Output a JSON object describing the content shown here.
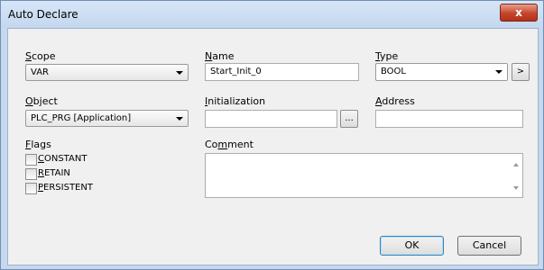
{
  "window": {
    "title": "Auto Declare",
    "close_label": "x"
  },
  "scope": {
    "label_ul": "S",
    "label_rest": "cope",
    "value": "VAR"
  },
  "name": {
    "label_ul": "N",
    "label_rest": "ame",
    "value": "Start_Init_0"
  },
  "type": {
    "label_ul": "T",
    "label_rest": "ype",
    "value": "BOOL",
    "browse_label": ">"
  },
  "object": {
    "label_ul": "O",
    "label_rest": "bject",
    "value": "PLC_PRG [Application]"
  },
  "initialization": {
    "label_ul": "I",
    "label_rest": "nitialization",
    "value": "",
    "browse_label": "..."
  },
  "address": {
    "label_ul": "A",
    "label_rest": "ddress",
    "value": ""
  },
  "flags": {
    "label_ul": "F",
    "label_rest": "lags",
    "items": [
      {
        "ul": "C",
        "rest": "ONSTANT"
      },
      {
        "ul": "R",
        "rest": "ETAIN"
      },
      {
        "ul": "P",
        "rest": "ERSISTENT"
      }
    ]
  },
  "comment": {
    "label_pre": "Co",
    "label_ul": "m",
    "label_rest": "ment",
    "value": ""
  },
  "buttons": {
    "ok": "OK",
    "cancel": "Cancel"
  }
}
